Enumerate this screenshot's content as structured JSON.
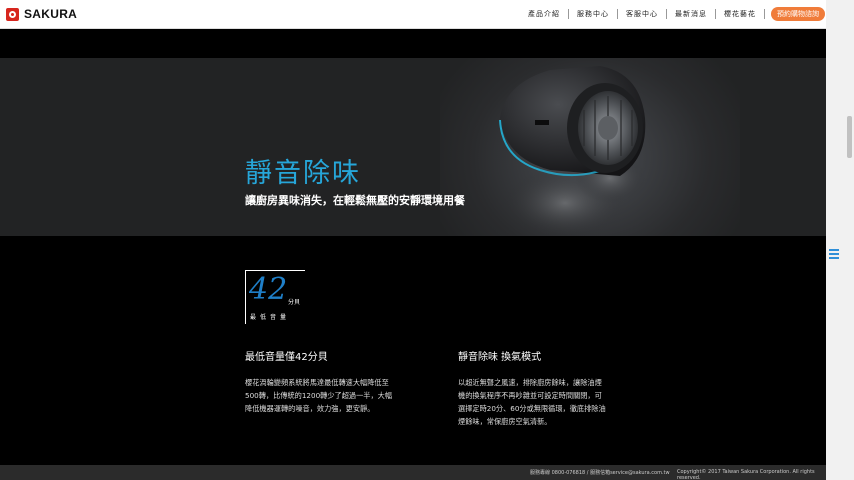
{
  "header": {
    "logo_text": "SAKURA",
    "nav": [
      "產品介紹",
      "服務中心",
      "客服中心",
      "最新消息",
      "櫻花藝花"
    ],
    "cta": "預約購物諮詢"
  },
  "hero": {
    "title": "靜音除味",
    "subtitle": "讓廚房異味消失，在輕鬆無壓的安靜環境用餐"
  },
  "badge": {
    "number": "42",
    "unit": "分貝",
    "label": "最低音量"
  },
  "features": [
    {
      "title": "最低音量僅42分貝",
      "text": "櫻花渦輪變頻系統將馬達最低轉速大幅降低至500轉，比傳統的1200轉少了超過一半，大幅降低機器運轉的噪音，效力強，更安靜。"
    },
    {
      "title": "靜音除味 換氣模式",
      "text": "以超近無聲之風速，排除廚房餘味，讓除油煙機的換氣程序不再吵雜並可設定時間關閉，可選擇定時20分、60分或無限循環，徹底排除油煙餘味，常保廚房空氣清新。"
    }
  ],
  "footer": {
    "contact": "服務專線 0800-076818 / 服務信箱service@sakura.com.tw",
    "copyright": "Copyright© 2017 Taiwan Sakura Corporation. All rights reserved."
  },
  "colors": {
    "accent_blue": "#26a6d9",
    "cta_orange": "#f07c3a",
    "brand_red": "#d7261e"
  }
}
